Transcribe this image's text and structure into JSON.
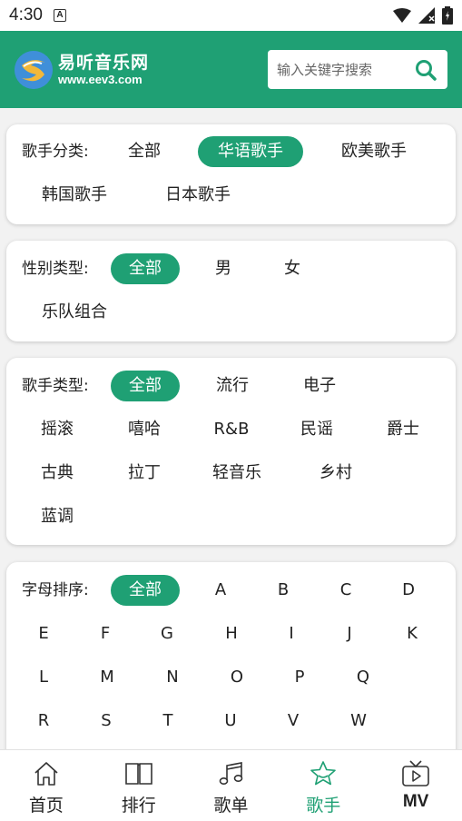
{
  "status": {
    "time": "4:30",
    "notif": "A"
  },
  "header": {
    "logo_cn": "易听音乐网",
    "logo_en": "www.eev3.com",
    "search_placeholder": "输入关键字搜索"
  },
  "filters": {
    "category": {
      "label": "歌手分类:",
      "options": [
        "全部",
        "华语歌手",
        "欧美歌手",
        "韩国歌手",
        "日本歌手"
      ],
      "selected": "华语歌手"
    },
    "gender": {
      "label": "性别类型:",
      "options": [
        "全部",
        "男",
        "女",
        "乐队组合"
      ],
      "selected": "全部"
    },
    "genre": {
      "label": "歌手类型:",
      "options": [
        "全部",
        "流行",
        "电子",
        "摇滚",
        "嘻哈",
        "R&B",
        "民谣",
        "爵士",
        "古典",
        "拉丁",
        "轻音乐",
        "乡村",
        "蓝调"
      ],
      "selected": "全部"
    },
    "letter": {
      "label": "字母排序:",
      "options": [
        "全部",
        "A",
        "B",
        "C",
        "D",
        "E",
        "F",
        "G",
        "H",
        "I",
        "J",
        "K",
        "L",
        "M",
        "N",
        "O",
        "P",
        "Q",
        "R",
        "S",
        "T",
        "U",
        "V",
        "W"
      ],
      "selected": "全部"
    }
  },
  "tabs": [
    {
      "label": "首页",
      "icon": "home-icon",
      "active": false
    },
    {
      "label": "排行",
      "icon": "book-icon",
      "active": false
    },
    {
      "label": "歌单",
      "icon": "music-note-icon",
      "active": false
    },
    {
      "label": "歌手",
      "icon": "star-icon",
      "active": true
    },
    {
      "label": "MV",
      "icon": "tv-icon",
      "active": false
    }
  ],
  "colors": {
    "accent": "#1fa074"
  }
}
